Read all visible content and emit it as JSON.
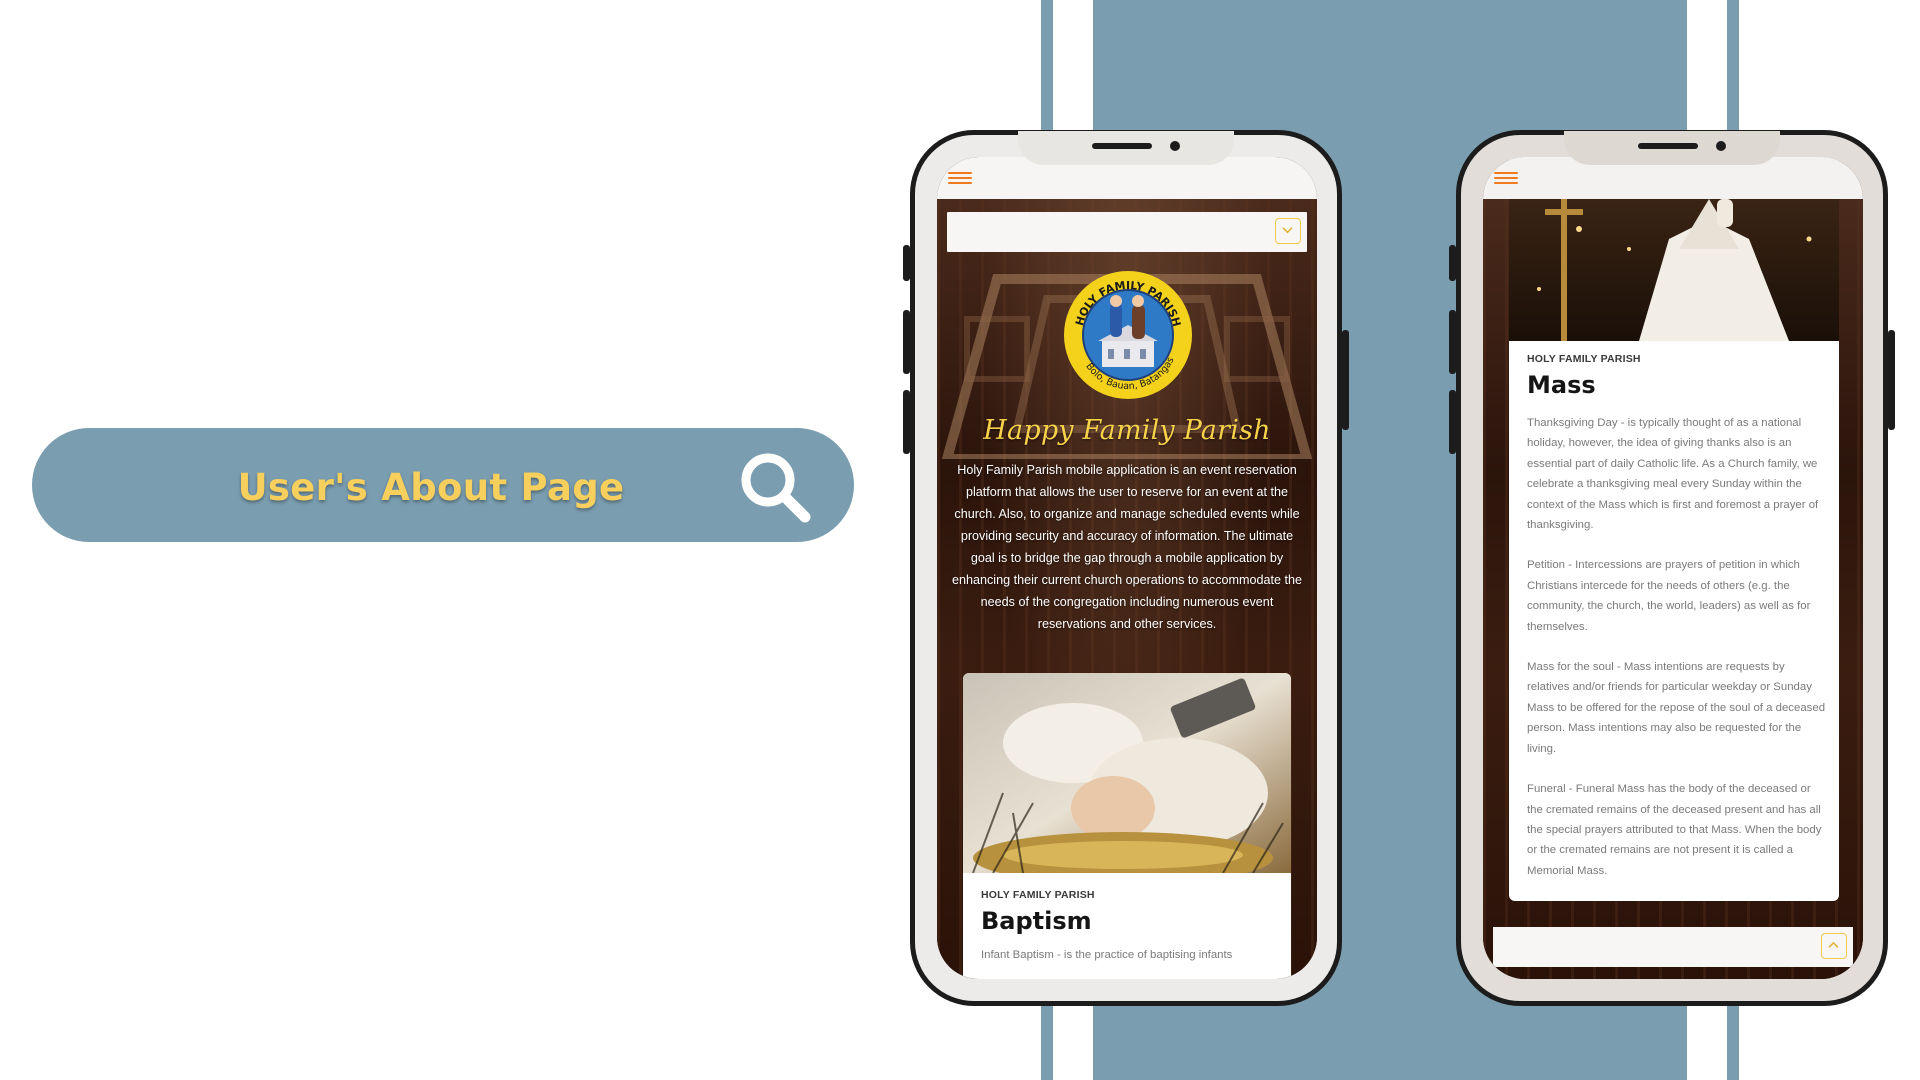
{
  "hero": {
    "title": "User's About Page",
    "search_icon": "search-icon"
  },
  "phone1": {
    "menu_icon": "hamburger-icon",
    "dropdown_icon": "chevron-down-icon",
    "logo": {
      "top_text": "HOLY FAMILY PARISH",
      "bottom_text": "Bolo, Bauan, Batangas"
    },
    "app_title": "Happy Family Parish",
    "app_description": "Holy Family Parish mobile application is an event reservation platform that allows the user to reserve for an event at the church. Also, to organize and manage scheduled events while providing security and accuracy of information. The ultimate goal is to bridge the gap through a mobile application by enhancing their current church operations to accommodate the needs of the congregation including numerous event reservations and other services.",
    "card": {
      "kicker": "HOLY FAMILY PARISH",
      "title": "Baptism",
      "body": "Infant Baptism - is the practice of baptising infants"
    }
  },
  "phone2": {
    "menu_icon": "hamburger-icon",
    "dropdown_icon": "chevron-up-icon",
    "card": {
      "kicker": "HOLY FAMILY PARISH",
      "title": "Mass",
      "paragraphs": [
        "Thanksgiving Day - is typically thought of as a national holiday, however, the idea of giving thanks also is an essential part of daily Catholic life. As a Church family, we celebrate a thanksgiving meal every Sunday within the context of the Mass which is first and foremost a prayer of thanksgiving.",
        "Petition - Intercessions are prayers of petition in which Christians intercede for the needs of others (e.g. the community, the church, the world, leaders) as well as for themselves.",
        "Mass for the soul - Mass intentions are requests by relatives and/or friends for particular weekday or Sunday Mass to be offered for the repose of the soul of a deceased person. Mass intentions may also be requested for the living.",
        "Funeral - Funeral Mass has the body of the deceased or the cremated remains of the deceased present and has all the special prayers attributed to that Mass. When the body or the cremated remains are not present it is called a Memorial Mass."
      ]
    }
  },
  "colors": {
    "background_stripe": "#7a9db0",
    "title_yellow": "#f6cf5d",
    "menu_orange": "#f07a1e"
  }
}
